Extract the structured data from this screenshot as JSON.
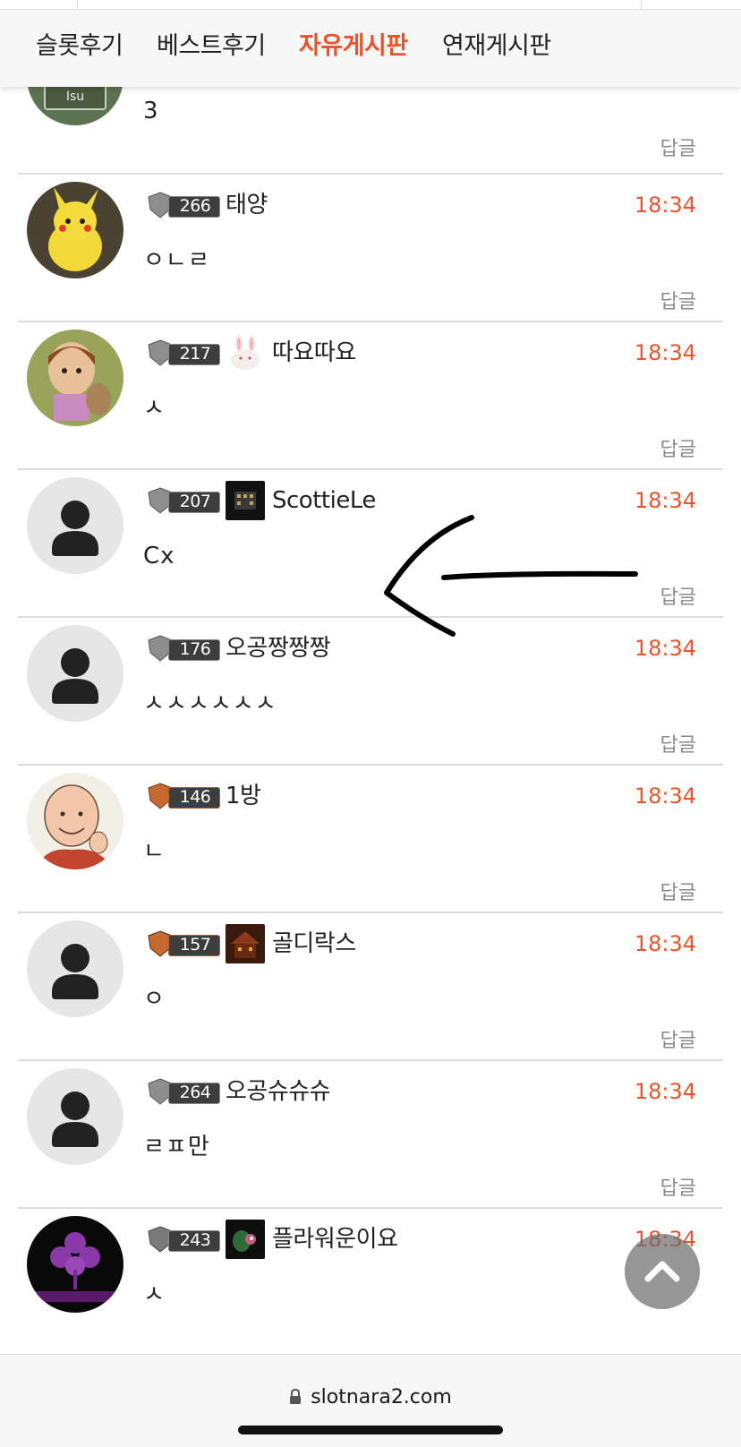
{
  "nav": {
    "tabs": [
      {
        "label": "슬롯후기",
        "active": false
      },
      {
        "label": "베스트후기",
        "active": false
      },
      {
        "label": "자유게시판",
        "active": true
      },
      {
        "label": "연재게시판",
        "active": false
      }
    ],
    "accent": "#e8542b"
  },
  "top_partial": {
    "text": "3",
    "reply_label": "답글"
  },
  "comments": [
    {
      "level": "266",
      "nickname": "태양",
      "time": "18:34",
      "text": "ㅇㄴㄹ",
      "reply_label": "답글",
      "avatar": "pikachu-avatar"
    },
    {
      "level": "217",
      "nickname": "따요따요",
      "time": "18:34",
      "text": "ㅅ",
      "reply_label": "답글",
      "avatar": "cartoon-character-avatar"
    },
    {
      "level": "207",
      "nickname": "ScottieLe",
      "time": "18:34",
      "text": "Cx",
      "reply_label": "답글",
      "avatar": "default-user-avatar"
    },
    {
      "level": "176",
      "nickname": "오공짱짱짱",
      "time": "18:34",
      "text": "ㅅㅅㅅㅅㅅㅅ",
      "reply_label": "답글",
      "avatar": "default-user-avatar"
    },
    {
      "level": "146",
      "nickname": "1방",
      "time": "18:34",
      "text": "ㄴ",
      "reply_label": "답글",
      "avatar": "bald-man-avatar"
    },
    {
      "level": "157",
      "nickname": "골디락스",
      "time": "18:34",
      "text": "ㅇ",
      "reply_label": "답글",
      "avatar": "default-user-avatar"
    },
    {
      "level": "264",
      "nickname": "오공슈슈슈",
      "time": "18:34",
      "text": "ㄹㅍ만",
      "reply_label": "답글",
      "avatar": "default-user-avatar"
    },
    {
      "level": "243",
      "nickname": "플라워운이요",
      "time": "18:34",
      "text": "ㅅ",
      "reply_label": "답글",
      "avatar": "purple-flower-avatar"
    }
  ],
  "browser": {
    "url": "slotnara2.com"
  },
  "icons": {
    "scroll_top": "chevron-up-icon",
    "lock": "lock-icon"
  }
}
